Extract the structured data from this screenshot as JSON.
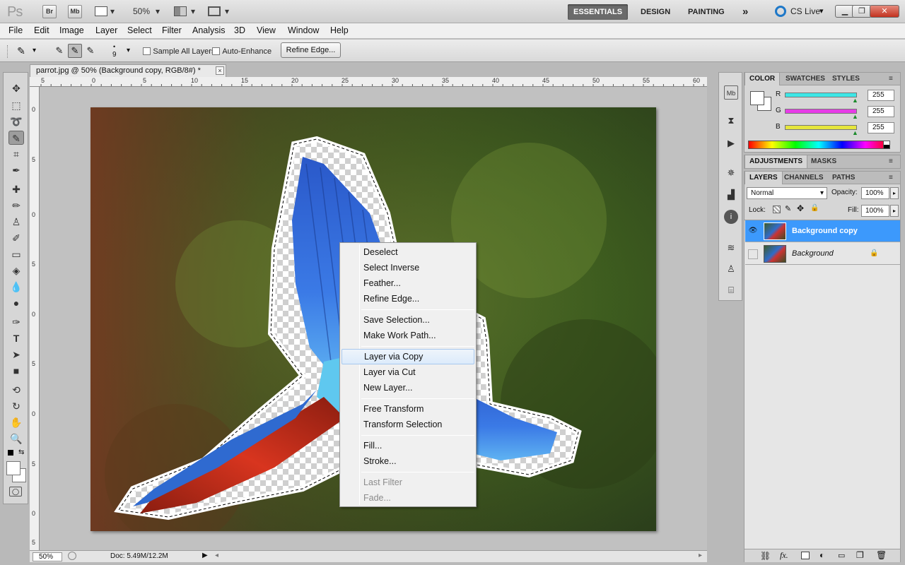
{
  "app": {
    "logo": "Ps",
    "launchers": [
      "Br",
      "Mb"
    ],
    "zoom": "50%",
    "workspaces": [
      "ESSENTIALS",
      "DESIGN",
      "PAINTING"
    ],
    "more": "»",
    "cslive": "CS Live"
  },
  "menubar": [
    "File",
    "Edit",
    "Image",
    "Layer",
    "Select",
    "Filter",
    "Analysis",
    "3D",
    "View",
    "Window",
    "Help"
  ],
  "options": {
    "brush_size": "9",
    "sample_all_layers": "Sample All Layers",
    "auto_enhance": "Auto-Enhance",
    "refine_edge": "Refine Edge..."
  },
  "document": {
    "tab_title": "parrot.jpg @ 50% (Background copy, RGB/8#) *",
    "close": "×",
    "ruler_h": [
      "5",
      "0",
      "5",
      "10",
      "15",
      "20",
      "25",
      "30",
      "35",
      "40",
      "45",
      "50",
      "55",
      "60"
    ],
    "ruler_v": [
      "0",
      "5",
      "0",
      "5",
      "0",
      "5",
      "0",
      "5",
      "0",
      "5"
    ]
  },
  "status": {
    "zoom": "50%",
    "doc": "Doc: 5.49M/12.2M"
  },
  "context_menu": {
    "items": [
      {
        "label": "Deselect",
        "state": "normal"
      },
      {
        "label": "Select Inverse",
        "state": "normal"
      },
      {
        "label": "Feather...",
        "state": "normal"
      },
      {
        "label": "Refine Edge...",
        "state": "normal"
      },
      {
        "label": "Save Selection...",
        "state": "normal"
      },
      {
        "label": "Make Work Path...",
        "state": "normal"
      },
      {
        "label": "Layer via Copy",
        "state": "highlighted"
      },
      {
        "label": "Layer via Cut",
        "state": "normal"
      },
      {
        "label": "New Layer...",
        "state": "normal"
      },
      {
        "label": "Free Transform",
        "state": "normal"
      },
      {
        "label": "Transform Selection",
        "state": "normal"
      },
      {
        "label": "Fill...",
        "state": "normal"
      },
      {
        "label": "Stroke...",
        "state": "normal"
      },
      {
        "label": "Last Filter",
        "state": "disabled"
      },
      {
        "label": "Fade...",
        "state": "disabled"
      }
    ]
  },
  "color_panel": {
    "tabs": [
      "COLOR",
      "SWATCHES",
      "STYLES"
    ],
    "channels": [
      {
        "name": "R",
        "value": "255",
        "color": "#3ce6e6"
      },
      {
        "name": "G",
        "value": "255",
        "color": "#e63ce6"
      },
      {
        "name": "B",
        "value": "255",
        "color": "#e6e63c"
      }
    ]
  },
  "adjustments_panel": {
    "tabs": [
      "ADJUSTMENTS",
      "MASKS"
    ]
  },
  "layers_panel": {
    "tabs": [
      "LAYERS",
      "CHANNELS",
      "PATHS"
    ],
    "blend_mode": "Normal",
    "opacity_label": "Opacity:",
    "opacity": "100%",
    "lock_label": "Lock:",
    "fill_label": "Fill:",
    "fill": "100%",
    "layers": [
      {
        "name": "Background copy",
        "selected": true,
        "visible": true
      },
      {
        "name": "Background",
        "selected": false,
        "visible": false,
        "locked": true
      }
    ]
  },
  "colors": {
    "accent_selected": "#3c99fc",
    "menu_highlight": "#dcebfb"
  }
}
